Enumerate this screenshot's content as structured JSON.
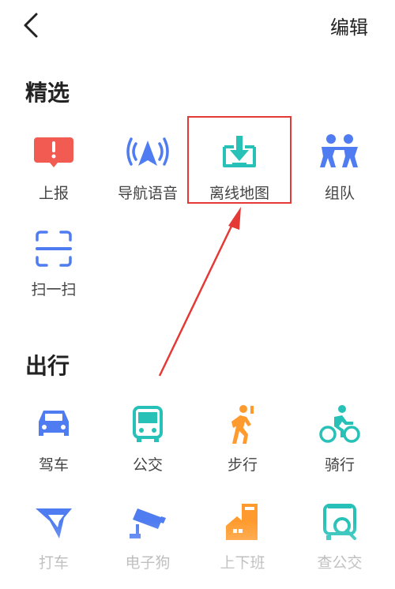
{
  "header": {
    "edit_label": "编辑"
  },
  "sections": {
    "featured": {
      "title": "精选",
      "items": [
        {
          "label": "上报",
          "icon": "report-alert-icon"
        },
        {
          "label": "导航语音",
          "icon": "navigation-voice-icon"
        },
        {
          "label": "离线地图",
          "icon": "offline-map-download-icon"
        },
        {
          "label": "组队",
          "icon": "team-people-icon"
        },
        {
          "label": "扫一扫",
          "icon": "scan-icon"
        }
      ]
    },
    "travel": {
      "title": "出行",
      "items": [
        {
          "label": "驾车",
          "icon": "car-icon"
        },
        {
          "label": "公交",
          "icon": "bus-icon"
        },
        {
          "label": "步行",
          "icon": "walk-icon"
        },
        {
          "label": "骑行",
          "icon": "bicycle-icon"
        },
        {
          "label": "打车",
          "icon": "taxi-icon"
        },
        {
          "label": "电子狗",
          "icon": "speed-camera-icon"
        },
        {
          "label": "上下班",
          "icon": "commute-home-icon"
        },
        {
          "label": "查公交",
          "icon": "bus-search-icon"
        }
      ]
    }
  },
  "colors": {
    "red": "#f25b52",
    "blue": "#4f7cf0",
    "teal": "#27c1b8",
    "orange": "#ff9b2e",
    "annotation": "#e53935"
  }
}
